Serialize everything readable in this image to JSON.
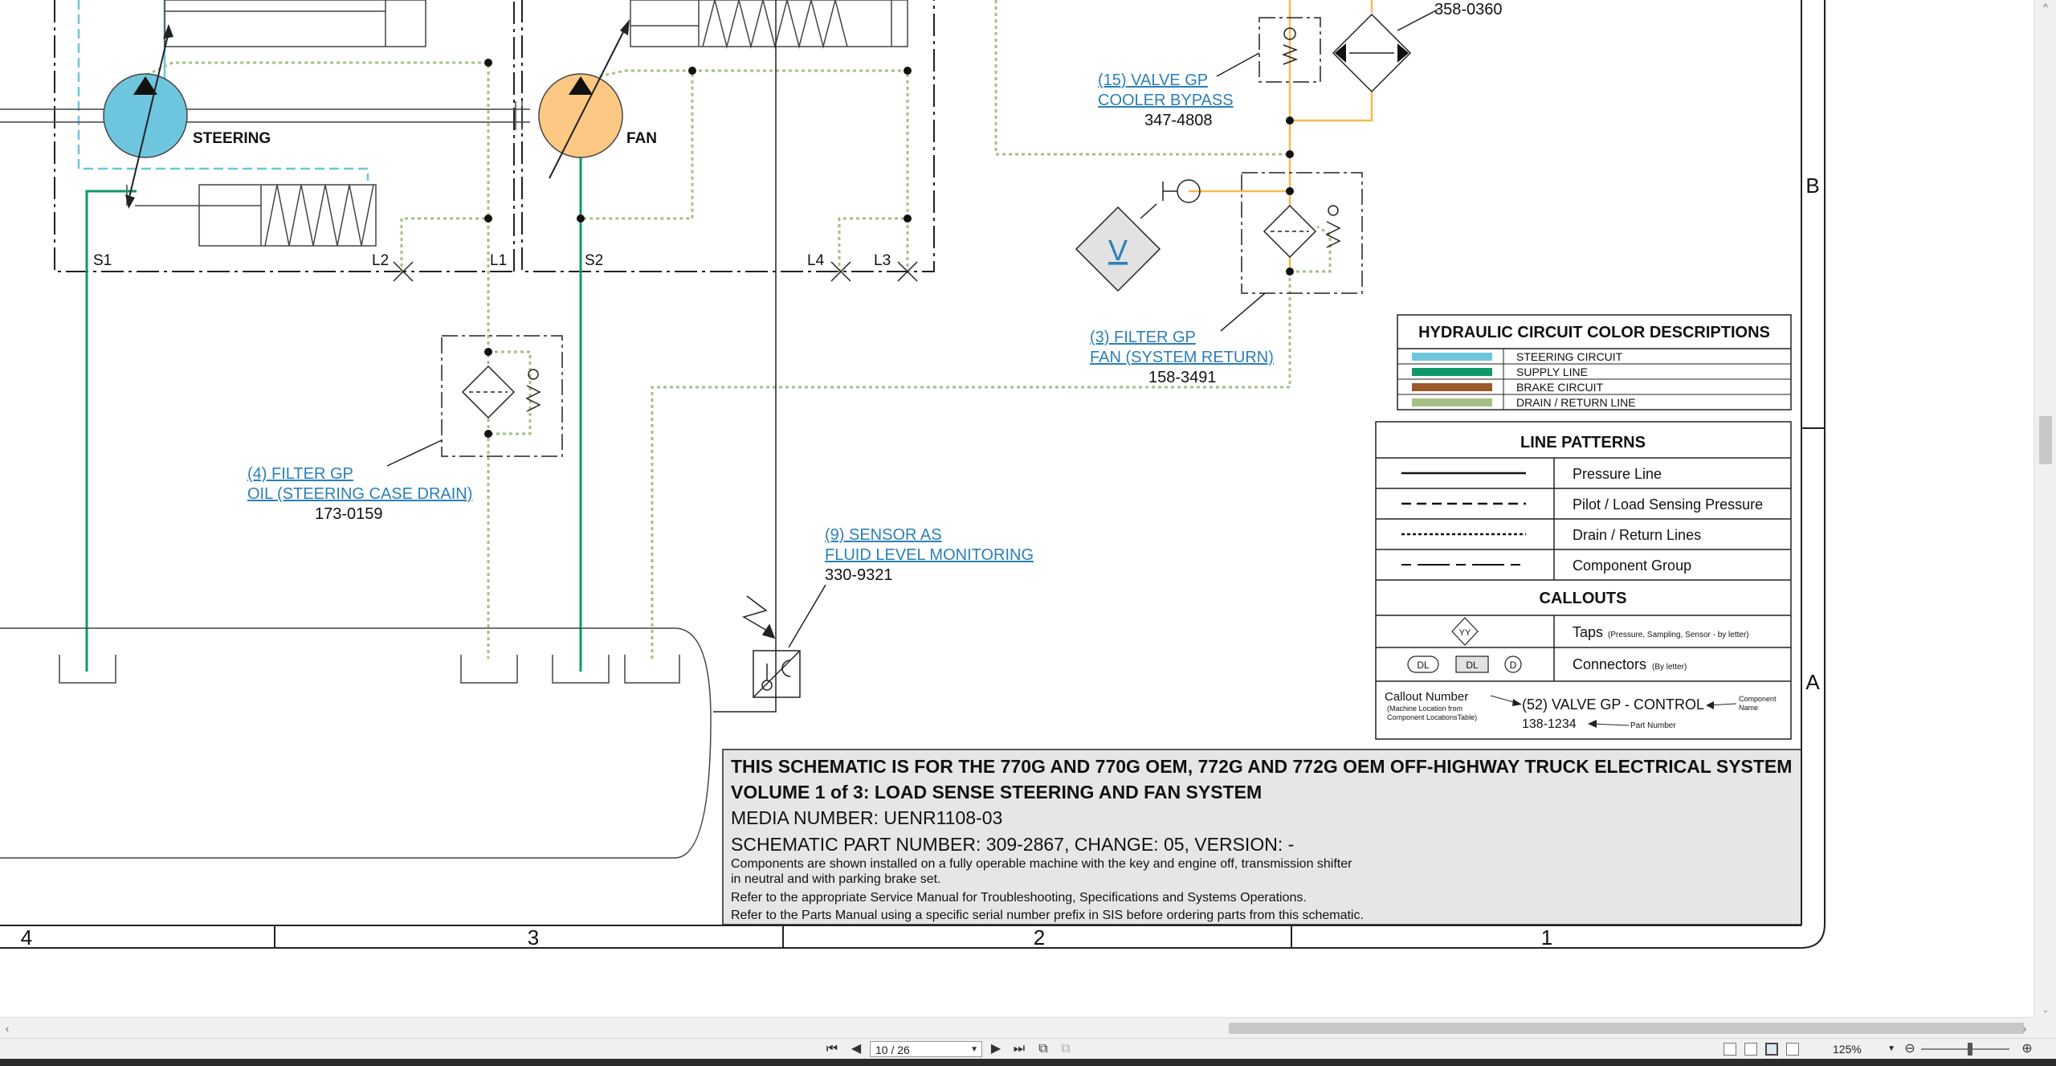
{
  "schematic": {
    "components": {
      "steering": "STEERING",
      "fan": "FAN",
      "ports": {
        "s1": "S1",
        "l2": "L2",
        "l1": "L1",
        "s2": "S2",
        "l4": "L4",
        "l3": "L3"
      },
      "top_part_number": "358-0360",
      "tap_letter": "V"
    },
    "callouts": {
      "valve_cooler_bypass": {
        "line1": "(15) VALVE GP",
        "line2": "COOLER BYPASS",
        "part": "347-4808"
      },
      "filter_fan_return": {
        "line1": "(3) FILTER GP",
        "line2": "FAN (SYSTEM RETURN)",
        "part": "158-3491"
      },
      "filter_oil_steering": {
        "line1": "(4) FILTER GP",
        "line2": "OIL (STEERING CASE DRAIN)",
        "part": "173-0159"
      },
      "sensor_fluid_level": {
        "line1": "(9) SENSOR AS",
        "line2": "FLUID LEVEL MONITORING",
        "part": "330-9321"
      }
    },
    "color_legend": {
      "title": "HYDRAULIC CIRCUIT COLOR DESCRIPTIONS",
      "items": [
        {
          "label": "STEERING CIRCUIT",
          "color": "#6ec6de"
        },
        {
          "label": "SUPPLY LINE",
          "color": "#0f9968"
        },
        {
          "label": "BRAKE CIRCUIT",
          "color": "#9b5a2a"
        },
        {
          "label": "DRAIN / RETURN LINE",
          "color": "#a6bf86"
        }
      ]
    },
    "line_patterns": {
      "title": "LINE PATTERNS",
      "items": [
        "Pressure Line",
        "Pilot / Load Sensing Pressure",
        "Drain / Return Lines",
        "Component Group"
      ],
      "callouts_title": "CALLOUTS",
      "taps_label": "Taps",
      "taps_note": "(Pressure, Sampling, Sensor - by letter)",
      "taps_symbol": "YY",
      "connectors_label": "Connectors",
      "connectors_note": "(By letter)",
      "connector_symbols": [
        "DL",
        "DL",
        "D"
      ],
      "example": {
        "callout_number": "Callout Number",
        "callout_note1": "(Machine Location from",
        "callout_note2": "Component LocationsTable)",
        "name": "(52) VALVE GP - CONTROL",
        "part": "138-1234",
        "component_name1": "Component",
        "component_name2": "Name",
        "part_number": "Part Number"
      }
    },
    "title_block": {
      "line1": "THIS SCHEMATIC IS FOR THE 770G AND 770G OEM, 772G AND 772G OEM OFF-HIGHWAY TRUCK ELECTRICAL SYSTEM",
      "line2": "VOLUME 1 of 3: LOAD SENSE STEERING AND FAN SYSTEM",
      "media": "MEDIA NUMBER: UENR1108-03",
      "part_number": "SCHEMATIC PART NUMBER: 309-2867, CHANGE: 05, VERSION: -",
      "note1": "Components are shown installed on a fully operable machine with the key and engine off, transmission shifter",
      "note2": "in neutral and with parking brake set.",
      "note3": "Refer to the appropriate Service Manual for Troubleshooting, Specifications and Systems Operations.",
      "note4": "Refer to the Parts Manual using a specific serial number prefix in SIS before ordering parts from this schematic."
    },
    "border": {
      "zones_bottom": [
        "4",
        "3",
        "2",
        "1"
      ],
      "zones_right": [
        "B",
        "A"
      ]
    }
  },
  "viewer": {
    "page_field": "10 / 26",
    "zoom": "125%"
  },
  "colors": {
    "steering": "#6ec6de",
    "supply": "#0f9968",
    "drain": "#a6bf86",
    "fan_pump": "#fcc883",
    "orange_line": "#f7b94d",
    "callout_blue": "#2b7fb7",
    "title_bg": "#e6e6e6"
  }
}
